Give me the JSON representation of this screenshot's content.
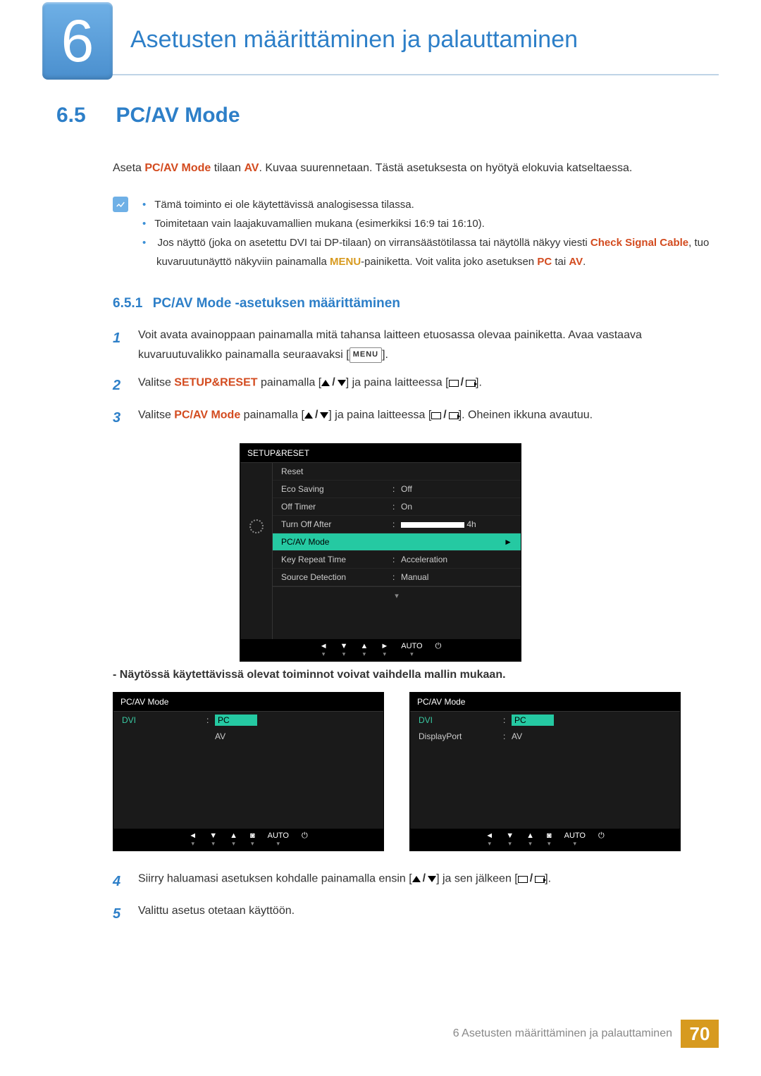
{
  "chapter": {
    "num": "6",
    "title": "Asetusten määrittäminen ja palauttaminen"
  },
  "section": {
    "num": "6.5",
    "title": "PC/AV Mode"
  },
  "intro": {
    "pre": "Aseta ",
    "code": "PC/AV Mode",
    "mid": " tilaan ",
    "av": "AV",
    "post": ". Kuvaa suurennetaan. Tästä asetuksesta on hyötyä elokuvia katseltaessa."
  },
  "notes": {
    "b1": "Tämä toiminto ei ole käytettävissä analogisessa tilassa.",
    "b2": "Toimitetaan vain laajakuvamallien mukana (esimerkiksi 16:9 tai 16:10).",
    "b3a": "Jos näyttö (joka on asetettu DVI tai DP-tilaan) on virransäästötilassa tai näytöllä näkyy viesti ",
    "b3c": "Check Signal Cable",
    "b3b": ", tuo kuvaruutunäyttö näkyviin painamalla ",
    "b3menu": "MENU",
    "b3d": "-painiketta. Voit valita joko asetuksen ",
    "b3pc": "PC",
    "b3or": " tai ",
    "b3av": "AV",
    "b3e": "."
  },
  "subsection": {
    "num": "6.5.1",
    "title": "PC/AV Mode -asetuksen määrittäminen"
  },
  "steps": {
    "s1": "Voit avata avainoppaan painamalla mitä tahansa laitteen etuosassa olevaa painiketta. Avaa vastaava kuvaruutuvalikko painamalla seuraavaksi [",
    "s1_menu": "MENU",
    "s1b": "].",
    "s2a": "Valitse ",
    "s2code": "SETUP&RESET",
    "s2b": " painamalla [",
    "s2c": "] ja paina laitteessa [",
    "s2d": "].",
    "s3a": "Valitse ",
    "s3code": "PC/AV Mode",
    "s3b": " painamalla [",
    "s3c": "] ja paina laitteessa [",
    "s3d": "]. Oheinen ikkuna avautuu.",
    "s4a": "Siirry haluamasi asetuksen kohdalle painamalla ensin [",
    "s4b": "] ja sen jälkeen [",
    "s4c": "].",
    "s5": "Valittu asetus otetaan käyttöön."
  },
  "osd1": {
    "title": "SETUP&RESET",
    "rows": {
      "reset": "Reset",
      "eco": "Eco Saving",
      "eco_v": "Off",
      "timer": "Off Timer",
      "timer_v": "On",
      "turnoff": "Turn Off After",
      "turnoff_v": "4h",
      "pcav": "PC/AV Mode",
      "keyrep": "Key Repeat Time",
      "keyrep_v": "Acceleration",
      "src": "Source Detection",
      "src_v": "Manual"
    },
    "footer": {
      "left": "◄",
      "down": "▼",
      "up": "▲",
      "right": "►",
      "auto": "AUTO",
      "pwr": "⏻"
    }
  },
  "postnote": "- Näytössä käytettävissä olevat toiminnot voivat vaihdella mallin mukaan.",
  "osd2": {
    "title": "PC/AV Mode",
    "dvi": "DVI",
    "dp": "DisplayPort",
    "pc": "PC",
    "av": "AV"
  },
  "footer": {
    "text": "6 Asetusten määrittäminen ja palauttaminen",
    "page": "70"
  }
}
